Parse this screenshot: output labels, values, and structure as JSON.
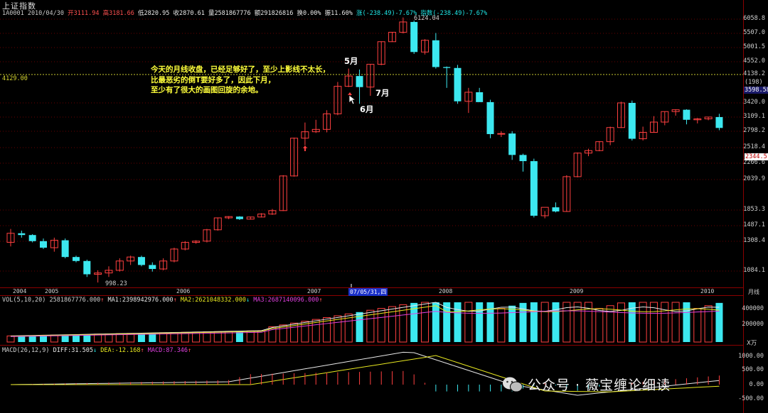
{
  "window": {
    "title": "上证指数"
  },
  "header": {
    "date": "1A0001 2010/04/30",
    "open": "开3111.94",
    "high": "高3181.66",
    "low": "低2820.95",
    "close": "收2870.61",
    "volume": "量2581867776",
    "amount": "额291826816",
    "turnover": "换0.00%",
    "amplitude": "振11.60%",
    "change": "涨(-238.49)-7.67%",
    "index": "指数(-238.49)-7.67%"
  },
  "price_axis": {
    "ticks": [
      "6058.8",
      "5507.0",
      "5001.5",
      "4552.0",
      "4138.2",
      "3420.0",
      "3109.1",
      "2798.2",
      "2518.4",
      "2266.6",
      "2039.9",
      "1853.3",
      "1487.1",
      "1308.4",
      "1084.1"
    ],
    "current_price": "3598.58",
    "current_badge": "(198)",
    "low_badge": "2344.5",
    "level_line": "4129.00"
  },
  "time_axis": {
    "years": [
      "2004",
      "2005",
      "2006",
      "2007",
      "2008",
      "2009",
      "2010"
    ],
    "cursor": "07/05/31,四",
    "period": "月线"
  },
  "annotations": {
    "high": "6124.04",
    "low": "998.23",
    "note_lines": [
      "今天的月线收盘，已经足够好了，至少上影线不太长，",
      "比最恶劣的倒T要好多了，因此下月，",
      "至少有了很大的画图回旋的余地。"
    ],
    "may": "5月",
    "june": "6月",
    "july": "7月"
  },
  "volume_panel": {
    "label": "VOL(5,10,20)",
    "value": "2581867776.000",
    "ma1": "MA1:2398942976.000",
    "ma2": "MA2:2621048332.000",
    "ma3": "MA3:2687140096.000",
    "ticks": [
      "400000",
      "200000"
    ],
    "unit": "万"
  },
  "macd_panel": {
    "label": "MACD(26,12,9)",
    "diff": "DIFF:31.505",
    "dea": "DEA:-12.168",
    "macd": "MACD:87.346",
    "ticks": [
      "1000.00",
      "500.00",
      "0.00",
      "-500.00"
    ]
  },
  "watermark": {
    "text": "公众号 · 薇宝缠论细读"
  },
  "colors": {
    "up": "#ff4040",
    "down": "#3ce8f0",
    "accent": "#ffff3a",
    "grid": "#8b0000",
    "ma1": "#e8e8e8",
    "ma2": "#e8e820",
    "ma3": "#e040e0"
  },
  "chart_data": {
    "type": "candlestick",
    "period": "monthly",
    "series": [
      {
        "o": 1300,
        "h": 1450,
        "l": 1270,
        "c": 1400
      },
      {
        "o": 1400,
        "h": 1430,
        "l": 1350,
        "c": 1380
      },
      {
        "o": 1380,
        "h": 1390,
        "l": 1300,
        "c": 1310
      },
      {
        "o": 1310,
        "h": 1340,
        "l": 1250,
        "c": 1260
      },
      {
        "o": 1260,
        "h": 1350,
        "l": 1230,
        "c": 1320
      },
      {
        "o": 1320,
        "h": 1340,
        "l": 1180,
        "c": 1190
      },
      {
        "o": 1190,
        "h": 1200,
        "l": 1150,
        "c": 1160
      },
      {
        "o": 1160,
        "h": 1170,
        "l": 1040,
        "c": 1060
      },
      {
        "o": 1060,
        "h": 1090,
        "l": 998,
        "c": 1070
      },
      {
        "o": 1070,
        "h": 1120,
        "l": 1040,
        "c": 1090
      },
      {
        "o": 1090,
        "h": 1180,
        "l": 1080,
        "c": 1160
      },
      {
        "o": 1160,
        "h": 1200,
        "l": 1130,
        "c": 1190
      },
      {
        "o": 1190,
        "h": 1200,
        "l": 1120,
        "c": 1130
      },
      {
        "o": 1130,
        "h": 1150,
        "l": 1080,
        "c": 1100
      },
      {
        "o": 1100,
        "h": 1180,
        "l": 1090,
        "c": 1160
      },
      {
        "o": 1160,
        "h": 1260,
        "l": 1150,
        "c": 1250
      },
      {
        "o": 1250,
        "h": 1310,
        "l": 1240,
        "c": 1300
      },
      {
        "o": 1300,
        "h": 1320,
        "l": 1290,
        "c": 1310
      },
      {
        "o": 1310,
        "h": 1450,
        "l": 1300,
        "c": 1440
      },
      {
        "o": 1440,
        "h": 1680,
        "l": 1430,
        "c": 1670
      },
      {
        "o": 1670,
        "h": 1710,
        "l": 1640,
        "c": 1700
      },
      {
        "o": 1700,
        "h": 1710,
        "l": 1620,
        "c": 1640
      },
      {
        "o": 1640,
        "h": 1700,
        "l": 1630,
        "c": 1690
      },
      {
        "o": 1690,
        "h": 1780,
        "l": 1680,
        "c": 1760
      },
      {
        "o": 1760,
        "h": 1860,
        "l": 1740,
        "c": 1840
      },
      {
        "o": 1840,
        "h": 2100,
        "l": 1830,
        "c": 2090
      },
      {
        "o": 2090,
        "h": 2690,
        "l": 2080,
        "c": 2680
      },
      {
        "o": 2680,
        "h": 2990,
        "l": 2560,
        "c": 2790
      },
      {
        "o": 2790,
        "h": 3050,
        "l": 2770,
        "c": 2840
      },
      {
        "o": 2840,
        "h": 3260,
        "l": 2780,
        "c": 3180
      },
      {
        "o": 3180,
        "h": 3950,
        "l": 3150,
        "c": 3840
      },
      {
        "o": 3840,
        "h": 4330,
        "l": 3820,
        "c": 4100
      },
      {
        "o": 4100,
        "h": 4300,
        "l": 3400,
        "c": 3820
      },
      {
        "o": 3820,
        "h": 4480,
        "l": 3600,
        "c": 4470
      },
      {
        "o": 4470,
        "h": 5220,
        "l": 4440,
        "c": 5210
      },
      {
        "o": 5210,
        "h": 5550,
        "l": 5200,
        "c": 5550
      },
      {
        "o": 5550,
        "h": 6124,
        "l": 5500,
        "c": 5950
      },
      {
        "o": 5950,
        "h": 6005,
        "l": 4800,
        "c": 4860
      },
      {
        "o": 4860,
        "h": 5300,
        "l": 4780,
        "c": 5260
      },
      {
        "o": 5260,
        "h": 5520,
        "l": 4330,
        "c": 4380
      },
      {
        "o": 4380,
        "h": 4400,
        "l": 3800,
        "c": 4350
      },
      {
        "o": 4350,
        "h": 4450,
        "l": 3400,
        "c": 3460
      },
      {
        "o": 3460,
        "h": 3800,
        "l": 3200,
        "c": 3690
      },
      {
        "o": 3690,
        "h": 3800,
        "l": 3600,
        "c": 3440
      },
      {
        "o": 3440,
        "h": 3500,
        "l": 2680,
        "c": 2750
      },
      {
        "o": 2750,
        "h": 2800,
        "l": 2700,
        "c": 2760
      },
      {
        "o": 2760,
        "h": 2800,
        "l": 2320,
        "c": 2400
      },
      {
        "o": 2400,
        "h": 2420,
        "l": 2150,
        "c": 2300
      },
      {
        "o": 2300,
        "h": 2340,
        "l": 1680,
        "c": 1720
      },
      {
        "o": 1720,
        "h": 1830,
        "l": 1660,
        "c": 1870
      },
      {
        "o": 1870,
        "h": 1900,
        "l": 1800,
        "c": 1820
      },
      {
        "o": 1820,
        "h": 2100,
        "l": 1810,
        "c": 2080
      },
      {
        "o": 2080,
        "h": 2440,
        "l": 2070,
        "c": 2430
      },
      {
        "o": 2430,
        "h": 2500,
        "l": 2380,
        "c": 2470
      },
      {
        "o": 2470,
        "h": 2630,
        "l": 2460,
        "c": 2620
      },
      {
        "o": 2620,
        "h": 2900,
        "l": 2560,
        "c": 2880
      },
      {
        "o": 2880,
        "h": 3450,
        "l": 2870,
        "c": 3420
      },
      {
        "o": 3420,
        "h": 3480,
        "l": 2640,
        "c": 2670
      },
      {
        "o": 2670,
        "h": 2900,
        "l": 2640,
        "c": 2780
      },
      {
        "o": 2780,
        "h": 3130,
        "l": 2780,
        "c": 3000
      },
      {
        "o": 3000,
        "h": 3230,
        "l": 2930,
        "c": 3230
      },
      {
        "o": 3230,
        "h": 3280,
        "l": 3140,
        "c": 3270
      },
      {
        "o": 3270,
        "h": 3280,
        "l": 2950,
        "c": 3050
      },
      {
        "o": 3050,
        "h": 3090,
        "l": 2970,
        "c": 3070
      },
      {
        "o": 3070,
        "h": 3110,
        "l": 3040,
        "c": 3110
      },
      {
        "o": 3110,
        "h": 3181,
        "l": 2821,
        "c": 2871
      }
    ]
  }
}
